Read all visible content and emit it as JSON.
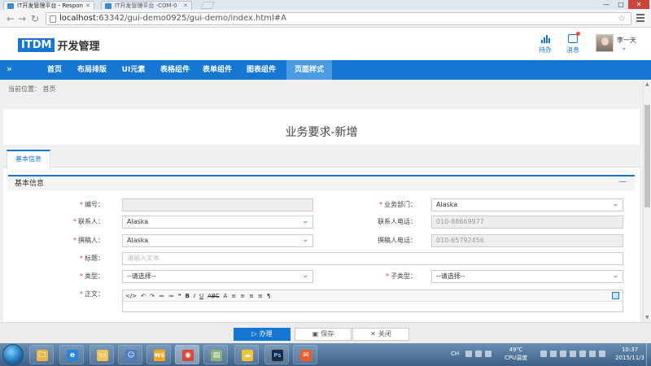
{
  "browser": {
    "tabs": [
      {
        "label": "IT开发管理平台 - Respon",
        "active": true
      },
      {
        "label": "IT开发管理平台 -COM-0",
        "active": false
      }
    ],
    "ghost_tab": "...",
    "url_host": "localhost",
    "url_path": ":63342/gui-demo0925/gui-demo/index.html#A",
    "window_buttons": [
      "—",
      "□",
      "✕"
    ]
  },
  "header": {
    "logo_box": "ITDM",
    "logo_text": "开发管理",
    "todo_label": "待办",
    "message_label": "消息",
    "user_name": "李一天"
  },
  "nav": {
    "items": [
      "首页",
      "布局排版",
      "UI元素",
      "表格组件",
      "表单组件",
      "图表组件",
      "页面样式"
    ],
    "active_index": 6
  },
  "breadcrumb": {
    "prefix": "当前位置：",
    "current": "首页"
  },
  "page": {
    "title": "业务要求-新增",
    "tab": "基本信息",
    "section_title": "基本信息",
    "collapse": "—"
  },
  "form": {
    "code_label": "编号：",
    "code_value": "",
    "dept_label": "业务部门：",
    "dept_value": "Alaska",
    "contact_label": "联系人：",
    "contact_value": "Alaska",
    "contact_phone_label": "联系人电话：",
    "contact_phone_value": "010-88669977",
    "writer_label": "撰稿人：",
    "writer_value": "Alaska",
    "writer_phone_label": "撰稿人电话：",
    "writer_phone_value": "010-65792456",
    "title_label": "标题：",
    "title_placeholder": "请输入文本",
    "type_label": "类型：",
    "type_value": "--请选择--",
    "subtype_label": "子类型：",
    "subtype_value": "--请选择--",
    "body_label": "正文："
  },
  "editor_toolbar": [
    "</>",
    "↶",
    "↷",
    "≔",
    "≔",
    "❝",
    "B",
    "I",
    "U",
    "ABC",
    "A",
    "≡",
    "≡",
    "≡",
    "≡",
    "¶"
  ],
  "actions": {
    "submit": "办理",
    "save": "保存",
    "close": "关闭"
  },
  "taskbar": {
    "apps": [
      {
        "name": "folder",
        "glyph": "🗀",
        "color": "#e8b64a"
      },
      {
        "name": "ie",
        "glyph": "e",
        "color": "#2a87d8"
      },
      {
        "name": "explorer",
        "glyph": "▭",
        "color": "#f0c560"
      },
      {
        "name": "photo",
        "glyph": "☺",
        "color": "#4a7cc0"
      },
      {
        "name": "webstorm",
        "glyph": "WS",
        "color": "#f5a623"
      },
      {
        "name": "chrome",
        "glyph": "◉",
        "color": "#d8453a"
      },
      {
        "name": "notes",
        "glyph": "▤",
        "color": "#8ab37a"
      },
      {
        "name": "cloud",
        "glyph": "☁",
        "color": "#f1c23a"
      },
      {
        "name": "photoshop",
        "glyph": "Ps",
        "color": "#1e2a3f"
      },
      {
        "name": "foxmail",
        "glyph": "✉",
        "color": "#e95b2a"
      }
    ],
    "ime": "CH",
    "temp": "49℃",
    "temp_label": "CPU温度",
    "time": "10:37",
    "date": "2015/11/3"
  },
  "colors": {
    "primary": "#1677d2",
    "nav_active": "#4b9be3",
    "required": "#e53935"
  }
}
